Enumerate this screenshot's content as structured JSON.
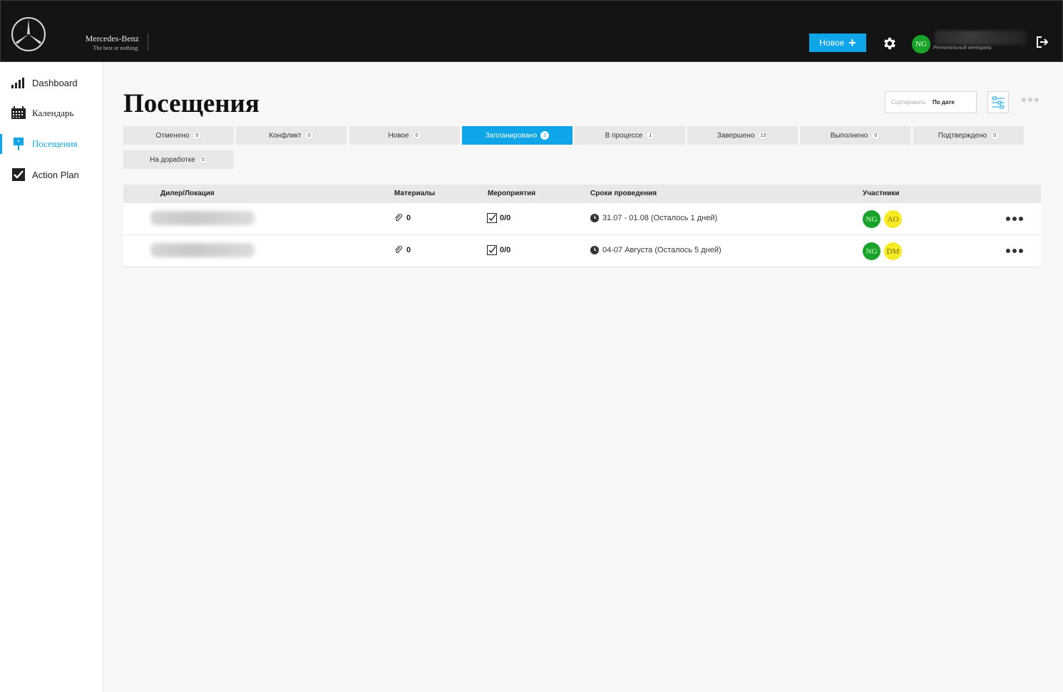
{
  "header": {
    "brand_name": "Mercedes-Benz",
    "brand_slogan": "The best or nothing.",
    "new_button_label": "Новое",
    "user_initials": "NG",
    "user_role": "Региональный менеджер"
  },
  "sidebar": {
    "items": [
      {
        "label": "Dashboard",
        "icon": "bar-chart-icon",
        "active": false
      },
      {
        "label": "Календарь",
        "icon": "calendar-icon",
        "active": false
      },
      {
        "label": "Посещения",
        "icon": "visit-marker-icon",
        "active": true
      },
      {
        "label": "Action Plan",
        "icon": "checkbox-checked-icon",
        "active": false
      }
    ]
  },
  "main": {
    "title": "Посещения",
    "sort_label": "Сортировать:",
    "sort_value": "По дате",
    "tabs": [
      {
        "label": "Отменено",
        "count": "0",
        "active": false
      },
      {
        "label": "Конфликт",
        "count": "0",
        "active": false
      },
      {
        "label": "Новое",
        "count": "0",
        "active": false
      },
      {
        "label": "Запланировано",
        "count": "2",
        "active": true
      },
      {
        "label": "В процессе",
        "count": "1",
        "active": false
      },
      {
        "label": "Завершено",
        "count": "13",
        "active": false
      },
      {
        "label": "Выполнено",
        "count": "0",
        "active": false
      },
      {
        "label": "Подтверждено",
        "count": "0",
        "active": false
      },
      {
        "label": "На доработке",
        "count": "0",
        "active": false
      }
    ],
    "table": {
      "columns": [
        "Дилер/Локация",
        "Материалы",
        "Мероприятия",
        "Сроки проведения",
        "Участники"
      ],
      "rows": [
        {
          "materials": "0",
          "events": "0/0",
          "dates": "31.07 - 01.08 (Осталось 1 дней)",
          "participants": [
            "NG",
            "AO"
          ]
        },
        {
          "materials": "0",
          "events": "0/0",
          "dates": "04-07 Августа (Осталось 5 дней)",
          "participants": [
            "NG",
            "DM"
          ]
        }
      ]
    }
  },
  "colors": {
    "accent": "#0ea5e9",
    "header_bg": "#141414",
    "avatar_green": "#1aa32b",
    "avatar_yellow": "#f5ea23"
  }
}
